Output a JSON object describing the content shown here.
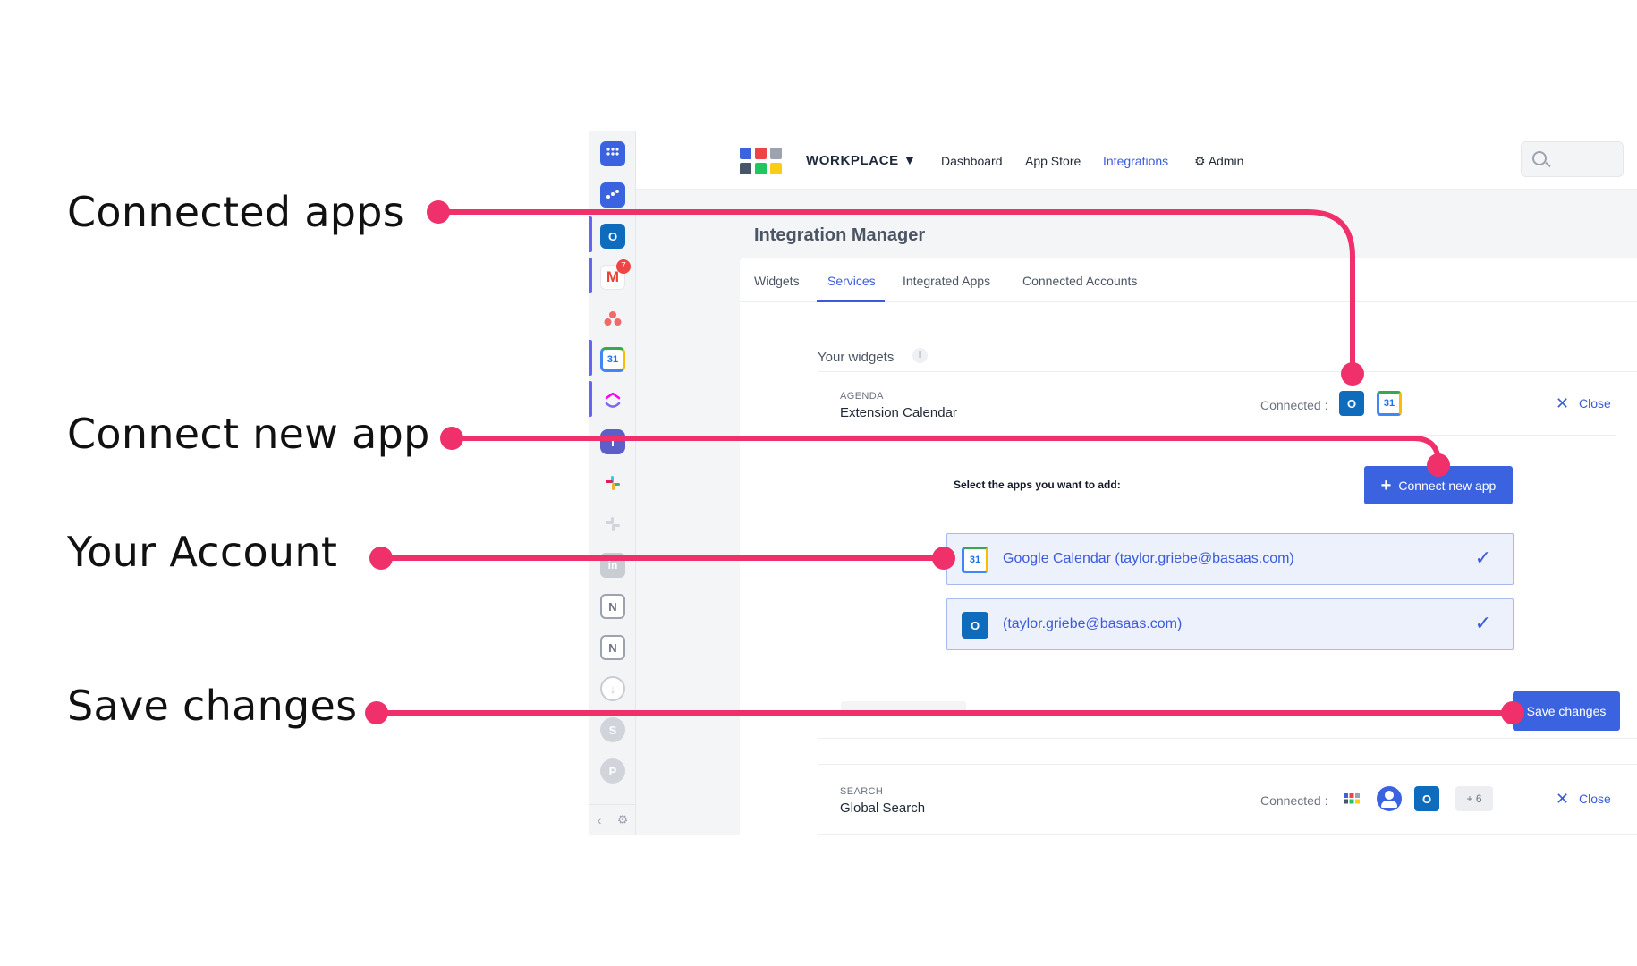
{
  "callouts": {
    "connected_apps": "Connected apps",
    "connect_new_app": "Connect new app",
    "your_account": "Your Account",
    "save_changes": "Save changes"
  },
  "colors": {
    "accent": "#3b63e0",
    "callout_line": "#f0306b",
    "link": "#3b5bdb"
  },
  "sidebar": {
    "items": [
      {
        "icon": "grid-icon"
      },
      {
        "icon": "widgets-icon"
      },
      {
        "icon": "outlook-icon"
      },
      {
        "icon": "gmail-icon",
        "badge": "7"
      },
      {
        "icon": "asana-icon"
      },
      {
        "icon": "google-calendar-icon"
      },
      {
        "icon": "clickup-icon"
      },
      {
        "icon": "teams-icon"
      },
      {
        "icon": "slack-icon"
      },
      {
        "icon": "slack-grey-icon"
      },
      {
        "icon": "linkedin-icon"
      },
      {
        "icon": "notion-icon"
      },
      {
        "icon": "notion-icon"
      },
      {
        "icon": "download-icon"
      },
      {
        "icon": "sharepoint-icon"
      },
      {
        "icon": "powerpoint-icon"
      }
    ]
  },
  "header": {
    "brand": "WORKPLACE ▼",
    "nav": {
      "dashboard": "Dashboard",
      "app_store": "App Store",
      "integrations": "Integrations",
      "admin": "Admin"
    }
  },
  "page": {
    "title": "Integration Manager",
    "tabs": {
      "widgets": "Widgets",
      "services": "Services",
      "integrated_apps": "Integrated Apps",
      "connected_accounts": "Connected Accounts"
    },
    "section_label": "Your widgets",
    "info": "i"
  },
  "agenda_card": {
    "kicker": "AGENDA",
    "title": "Extension Calendar",
    "connected_label": "Connected :",
    "close": "Close",
    "select_label": "Select the apps you want to add:",
    "connect_button": "Connect new app",
    "accounts": [
      {
        "app": "google-calendar-icon",
        "label": "Google Calendar (taylor.griebe@basaas.com)",
        "selected": true
      },
      {
        "app": "outlook-icon",
        "label": "(taylor.griebe@basaas.com)",
        "selected": true
      }
    ],
    "save_button": "Save changes",
    "calendar_day": "31",
    "outlook_letter": "O"
  },
  "search_card": {
    "kicker": "SEARCH",
    "title": "Global Search",
    "connected_label": "Connected :",
    "more": "+ 6",
    "close": "Close"
  }
}
